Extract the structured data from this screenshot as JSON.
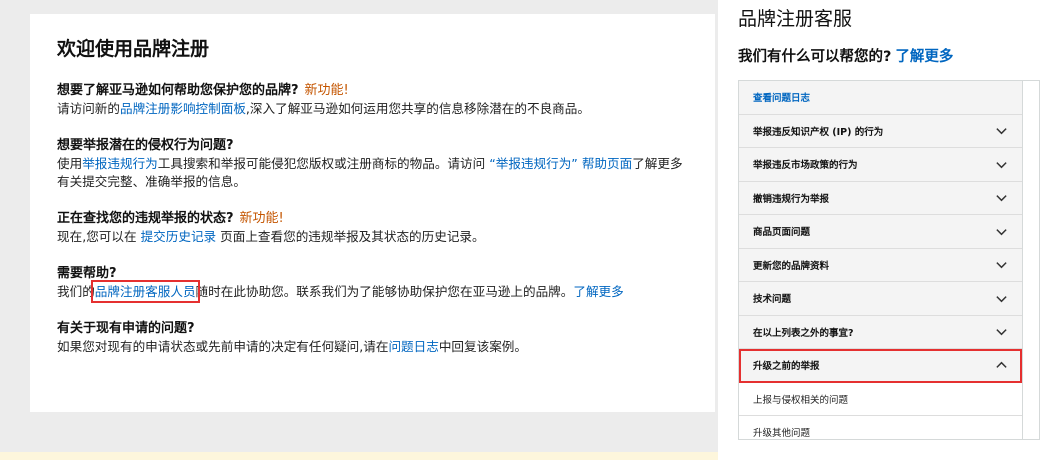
{
  "welcome": {
    "title": "欢迎使用品牌注册",
    "sections": [
      {
        "heading": "想要了解亚马逊如何帮助您保护您的品牌?",
        "new": "新功能!",
        "p1": "请访问新的",
        "link1": "品牌注册影响控制面板",
        "p2": ",深入了解亚马逊如何运用您共享的信息移除潜在的不良商品。"
      },
      {
        "heading": "想要举报潜在的侵权行为问题?",
        "p1": "使用",
        "link1": "举报违规行为",
        "p2": "工具搜索和举报可能侵犯您版权或注册商标的物品。请访问 ",
        "link2": "“举报违规行为” 帮助页面",
        "p3": "了解更多有关提交完整、准确举报的信息。"
      },
      {
        "heading": "正在查找您的违规举报的状态?",
        "new": "新功能!",
        "p1": "现在,您可以在 ",
        "link1": "提交历史记录",
        "p2": " 页面上查看您的违规举报及其状态的历史记录。"
      },
      {
        "heading": "需要帮助?",
        "p1": "我们的",
        "link1": "品牌注册客服人员",
        "p2": "随时在此协助您。联系我们为了能够协助保护您在亚马逊上的品牌。",
        "link2": "了解更多"
      },
      {
        "heading": "有关于现有申请的问题?",
        "p1": "如果您对现有的申请状态或先前申请的决定有任何疑问,请在",
        "link1": "问题日志",
        "p2": "中回复该案例。"
      }
    ]
  },
  "panel": {
    "title": "品牌注册客服",
    "help_text": "我们有什么可以帮您的?",
    "learn_more": "了解更多",
    "items": [
      {
        "label": "查看问题日志"
      },
      {
        "label": "举报违反知识产权 (IP) 的行为"
      },
      {
        "label": "举报违反市场政策的行为"
      },
      {
        "label": "撤销违规行为举报"
      },
      {
        "label": "商品页面问题"
      },
      {
        "label": "更新您的品牌资料"
      },
      {
        "label": "技术问题"
      },
      {
        "label": "在以上列表之外的事宜?"
      },
      {
        "label": "升级之前的举报"
      },
      {
        "label": "上报与侵权相关的问题"
      },
      {
        "label": "升级其他问题"
      }
    ]
  },
  "colors": {
    "link": "#0066c0",
    "new_badge": "#c45500",
    "highlight": "#e53030"
  },
  "icons": {
    "collapsed": "chevron-down-icon",
    "expanded": "chevron-up-icon"
  }
}
